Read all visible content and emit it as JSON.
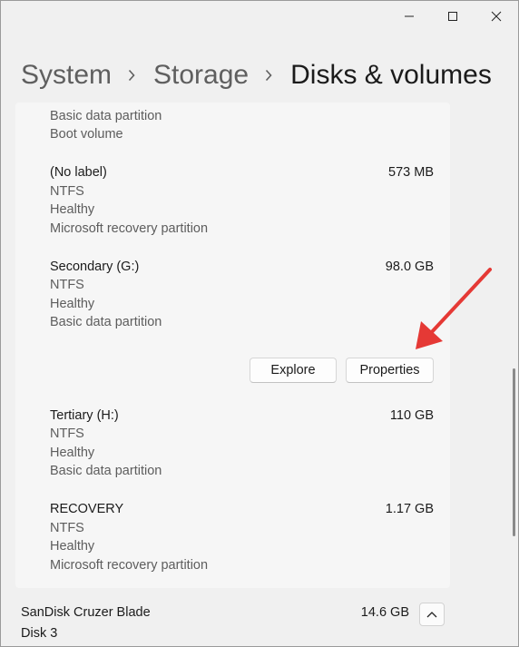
{
  "breadcrumb": {
    "items": [
      "System",
      "Storage",
      "Disks & volumes"
    ]
  },
  "partial_top": {
    "lines": [
      "Basic data partition",
      "Boot volume"
    ]
  },
  "volumes": [
    {
      "name": "(No label)",
      "size": "573 MB",
      "fs": "NTFS",
      "health": "Healthy",
      "type": "Microsoft recovery partition"
    },
    {
      "name": "Secondary (G:)",
      "size": "98.0 GB",
      "fs": "NTFS",
      "health": "Healthy",
      "type": "Basic data partition"
    },
    {
      "name": "Tertiary (H:)",
      "size": "110 GB",
      "fs": "NTFS",
      "health": "Healthy",
      "type": "Basic data partition"
    },
    {
      "name": "RECOVERY",
      "size": "1.17 GB",
      "fs": "NTFS",
      "health": "Healthy",
      "type": "Microsoft recovery partition"
    }
  ],
  "actions": {
    "explore": "Explore",
    "properties": "Properties"
  },
  "drive": {
    "name": "SanDisk Cruzer Blade",
    "disk": "Disk 3",
    "size": "14.6 GB"
  },
  "icons": {
    "minimize": "minimize-icon",
    "maximize": "maximize-icon",
    "close": "close-icon",
    "separator": "chevron-right-icon",
    "collapse": "chevron-up-icon"
  },
  "colors": {
    "annotation_arrow": "#e53935",
    "background": "#f0f0f0",
    "panel": "#f6f6f6"
  }
}
